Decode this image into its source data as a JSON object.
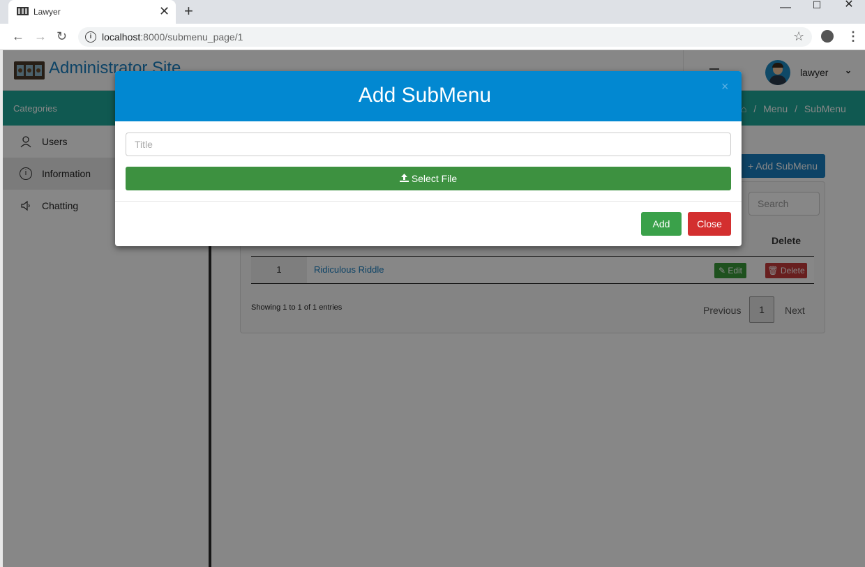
{
  "browser": {
    "tab_title": "Lawyer",
    "tab_close": "✕",
    "new_tab": "+",
    "url_host": "localhost",
    "url_path": ":8000/submenu_page/1",
    "window_controls": [
      "—",
      "☐",
      "✕"
    ]
  },
  "header": {
    "site_title": "Administrator Site",
    "username": "lawyer"
  },
  "nav_bar": {
    "categories_label": "Categories",
    "breadcrumb": [
      "Menu",
      "/",
      "SubMenu"
    ]
  },
  "sidebar": {
    "items": [
      {
        "label": "Users",
        "icon": "user-icon"
      },
      {
        "label": "Information",
        "icon": "info-icon",
        "active": true
      },
      {
        "label": "Chatting",
        "icon": "speaker-icon"
      }
    ]
  },
  "main": {
    "add_submenu_label": "+ Add SubMenu",
    "search_placeholder": "Search",
    "table": {
      "delete_header": "Delete",
      "rows": [
        {
          "num": "1",
          "title": "Ridiculous Riddle",
          "edit_label": "✎ Edit",
          "delete_label": "🗑 Delete"
        }
      ]
    },
    "showing": "Showing 1 to 1 of 1 entries",
    "pagination": {
      "previous": "Previous",
      "page": "1",
      "next": "Next"
    }
  },
  "modal": {
    "title": "Add SubMenu",
    "close_x": "×",
    "title_placeholder": "Title",
    "select_file_label": "Select File",
    "add_label": "Add",
    "close_label": "Close"
  },
  "colors": {
    "brand_blue": "#0288d1",
    "teal": "#1fa89a",
    "success": "#3d9140",
    "danger": "#d32f2f"
  }
}
